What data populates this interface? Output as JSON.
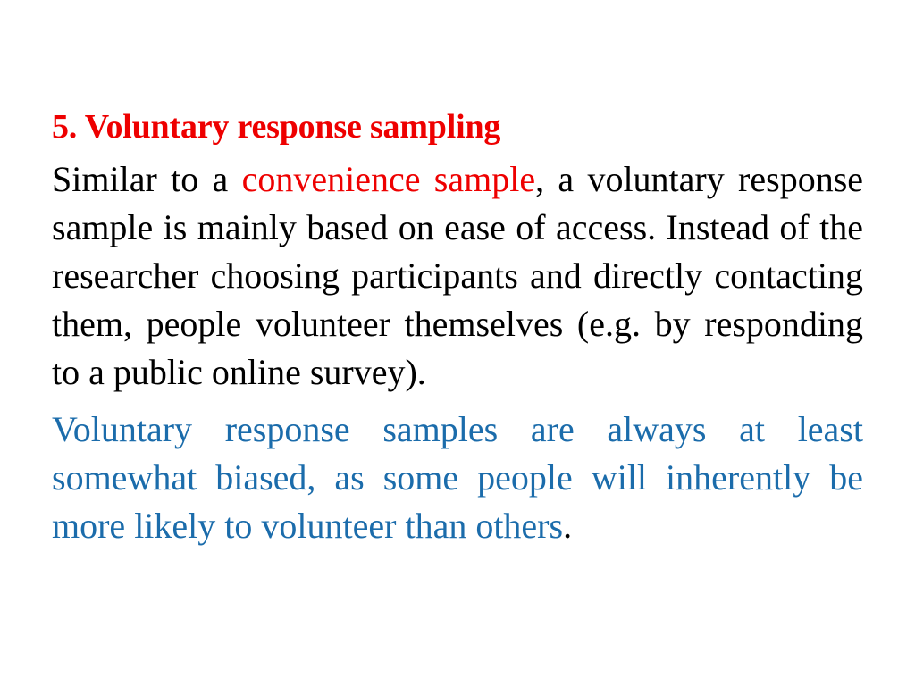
{
  "slide": {
    "background_color": "#ffffff",
    "title": "5. Voluntary response sampling",
    "title_color": "#ee0000",
    "body": {
      "paragraph_1": {
        "color": "#000000",
        "segment_1": "Similar to a ",
        "highlight": "convenience sample",
        "highlight_color": "#ee0000",
        "segment_2": ", a voluntary response sample is mainly based on ease of access. Instead of the researcher choosing participants and directly contacting them, people volunteer themselves (e.g. by responding to a public online survey)."
      },
      "paragraph_2": {
        "color": "#1b6cab",
        "text": "Voluntary response samples are always at least somewhat biased, as some people will inherently be more likely to volunteer than others",
        "terminal_punctuation": ".",
        "terminal_punctuation_color": "#000000"
      }
    }
  }
}
